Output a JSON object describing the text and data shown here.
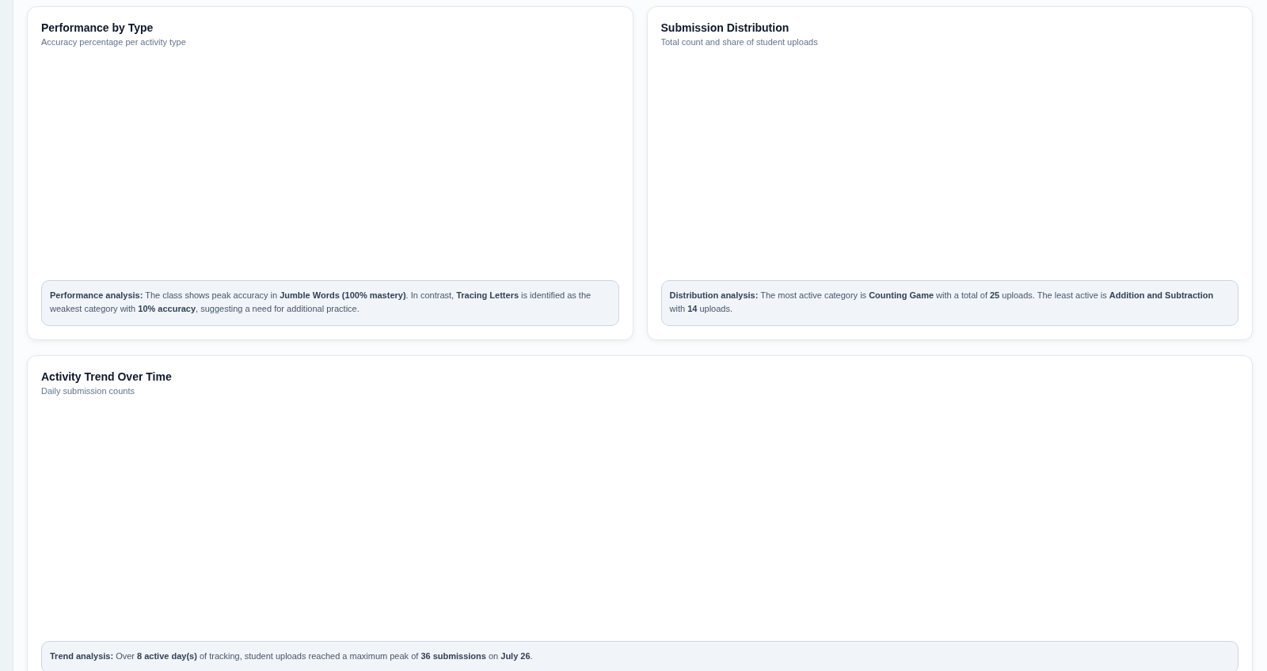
{
  "cards": [
    {
      "title": "Performance by Type",
      "subtitle": "Accuracy percentage per activity type",
      "analysis": "**Performance analysis:** The class shows peak accuracy in **Jumble Words (100% mastery)**. In contrast, **Tracing Letters** is identified as the weakest category with **10% accuracy**, suggesting a need for additional practice."
    },
    {
      "title": "Submission Distribution",
      "subtitle": "Total count and share of student uploads",
      "analysis": "**Distribution analysis:** The most active category is **Counting Game** with a total of **25** uploads. The least active is **Addition and Subtraction** with **14** uploads."
    },
    {
      "title": "Activity Trend Over Time",
      "subtitle": "Daily submission counts",
      "analysis": "**Trend analysis:** Over **8 active day(s)** of tracking, student uploads reached a maximum peak of **36 submissions** on **July 26**."
    }
  ]
}
